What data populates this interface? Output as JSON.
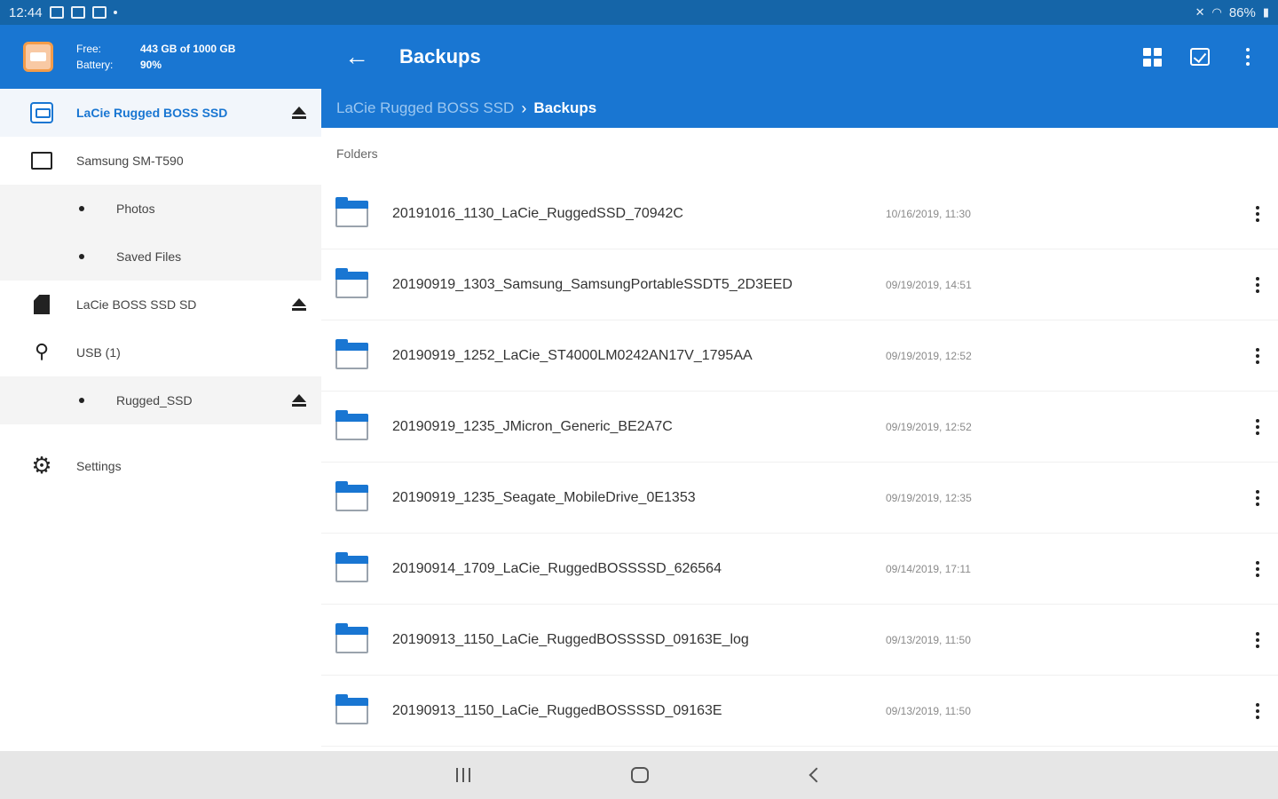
{
  "status_bar": {
    "time": "12:44",
    "battery": "86%",
    "icons": [
      "gallery-icon",
      "storage-icon",
      "photo-icon",
      "dot-icon",
      "mute-icon",
      "wifi-icon",
      "battery-icon"
    ]
  },
  "device_header": {
    "free_label": "Free:",
    "free_value": "443 GB of 1000 GB",
    "battery_label": "Battery:",
    "battery_value": "90%"
  },
  "appbar": {
    "title": "Backups"
  },
  "breadcrumb": {
    "root": "LaCie Rugged BOSS SSD",
    "current": "Backups"
  },
  "sidebar": {
    "items": [
      {
        "label": "LaCie Rugged BOSS SSD",
        "icon": "drive-icon",
        "active": true,
        "eject": true
      },
      {
        "label": "Samsung SM-T590",
        "icon": "tablet-icon"
      },
      {
        "label": "Photos",
        "sub": true
      },
      {
        "label": "Saved Files",
        "sub": true
      },
      {
        "label": "LaCie BOSS SSD SD",
        "icon": "sd-card-icon",
        "eject": true
      },
      {
        "label": "USB (1)",
        "icon": "usb-icon"
      },
      {
        "label": "Rugged_SSD",
        "sub": true,
        "eject": true
      },
      {
        "label": "Settings",
        "icon": "gear-icon"
      }
    ]
  },
  "main": {
    "section_label": "Folders",
    "folders": [
      {
        "name": "20191016_1130_LaCie_RuggedSSD_70942C",
        "date": "10/16/2019, 11:30"
      },
      {
        "name": "20190919_1303_Samsung_SamsungPortableSSDT5_2D3EED",
        "date": "09/19/2019, 14:51"
      },
      {
        "name": "20190919_1252_LaCie_ST4000LM0242AN17V_1795AA",
        "date": "09/19/2019, 12:52"
      },
      {
        "name": "20190919_1235_JMicron_Generic_BE2A7C",
        "date": "09/19/2019, 12:52"
      },
      {
        "name": "20190919_1235_Seagate_MobileDrive_0E1353",
        "date": "09/19/2019, 12:35"
      },
      {
        "name": "20190914_1709_LaCie_RuggedBOSSSSD_626564",
        "date": "09/14/2019, 17:11"
      },
      {
        "name": "20190913_1150_LaCie_RuggedBOSSSSD_09163E_log",
        "date": "09/13/2019, 11:50"
      },
      {
        "name": "20190913_1150_LaCie_RuggedBOSSSSD_09163E",
        "date": "09/13/2019, 11:50"
      }
    ]
  },
  "colors": {
    "primary": "#1976d2",
    "status_bar": "#1565a8",
    "breadcrumb_root": "#9cc7f0"
  }
}
